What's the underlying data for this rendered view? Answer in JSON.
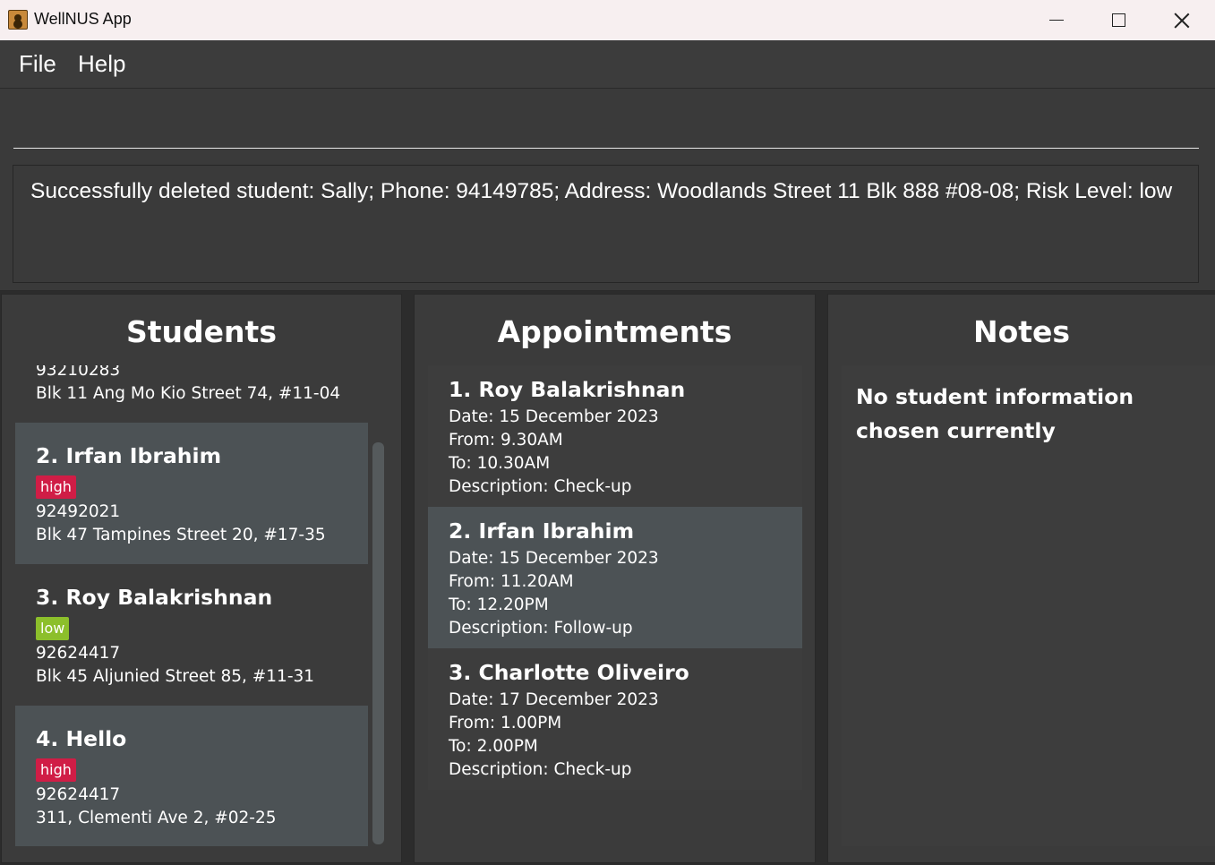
{
  "window": {
    "title": "WellNUS App"
  },
  "menu": {
    "file": "File",
    "help": "Help"
  },
  "command": {
    "value": "",
    "placeholder": ""
  },
  "result": {
    "message": "Successfully deleted student: Sally; Phone: 94149785; Address: Woodlands Street 11 Blk 888 #08-08; Risk Level: low"
  },
  "students": {
    "title": "Students",
    "partial": {
      "phone": "93210283",
      "address": "Blk 11 Ang Mo Kio Street 74, #11-04"
    },
    "items": [
      {
        "name": "2.  Irfan Ibrahim",
        "risk": "high",
        "phone": "92492021",
        "address": "Blk 47 Tampines Street 20, #17-35"
      },
      {
        "name": "3.  Roy Balakrishnan",
        "risk": "low",
        "phone": "92624417",
        "address": "Blk 45 Aljunied Street 85, #11-31"
      },
      {
        "name": "4.  Hello",
        "risk": "high",
        "phone": "92624417",
        "address": "311, Clementi Ave 2, #02-25"
      }
    ]
  },
  "appointments": {
    "title": "Appointments",
    "items": [
      {
        "name": "1.  Roy Balakrishnan",
        "date": "Date: 15 December 2023",
        "from": "From: 9.30AM",
        "to": "To: 10.30AM",
        "description": "Description: Check-up"
      },
      {
        "name": "2.  Irfan Ibrahim",
        "date": "Date: 15 December 2023",
        "from": "From: 11.20AM",
        "to": "To: 12.20PM",
        "description": "Description: Follow-up"
      },
      {
        "name": "3.  Charlotte Oliveiro",
        "date": "Date: 17 December 2023",
        "from": "From: 1.00PM",
        "to": "To: 2.00PM",
        "description": "Description: Check-up"
      }
    ]
  },
  "notes": {
    "title": "Notes",
    "message": "No student information chosen currently"
  },
  "colors": {
    "risk_high": "#d01d46",
    "risk_low": "#8cbf2b",
    "panel_bg": "#3b3b3b",
    "card_alt": "#4c5255"
  },
  "icons": {
    "app": "app-icon",
    "minimize": "minimize-icon",
    "maximize": "maximize-icon",
    "close": "close-icon"
  }
}
